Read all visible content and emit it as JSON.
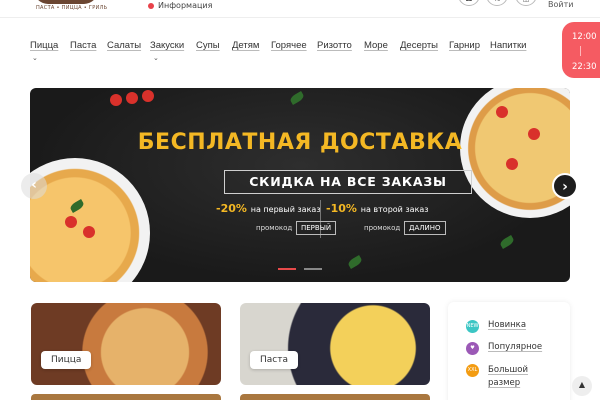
{
  "header": {
    "tagline": "ПАСТА • ПИЦЦА • ГРИЛЬ",
    "info_label": "Информация",
    "login_label": "Войти"
  },
  "nav": {
    "items": [
      "Пицца",
      "Паста",
      "Салаты",
      "Закуски",
      "Супы",
      "Детям",
      "Горячее",
      "Ризотто",
      "Море",
      "Десерты",
      "Гарнир",
      "Напитки"
    ]
  },
  "hours": {
    "open": "12:00",
    "close": "22:30"
  },
  "banner": {
    "headline": "БЕСПЛАТНАЯ ДОСТАВКА",
    "subheadline": "СКИДКА НА ВСЕ ЗАКАЗЫ",
    "promo1_percent": "-20%",
    "promo1_text": "на первый заказ",
    "promo1_label": "промокод",
    "promo1_code": "ПЕРВЫЙ",
    "promo2_percent": "-10%",
    "promo2_text": "на второй заказ",
    "promo2_label": "промокод",
    "promo2_code": "ДАЛИНО",
    "arrow_left": "‹",
    "arrow_right": "›",
    "slide_count": 2,
    "active_slide": 1
  },
  "categories": [
    {
      "label": "Пицца"
    },
    {
      "label": "Паста"
    }
  ],
  "legend": {
    "items": [
      {
        "icon_text": "NEW",
        "label": "Новинка",
        "color": "#3cc6c4"
      },
      {
        "icon_text": "♥",
        "label": "Популярное",
        "color": "#9b59b6"
      },
      {
        "icon_text": "XXL",
        "label": "Большой размер",
        "color": "#f39c12"
      }
    ]
  },
  "colors": {
    "accent": "#f55b62",
    "headline": "#f4b824"
  }
}
